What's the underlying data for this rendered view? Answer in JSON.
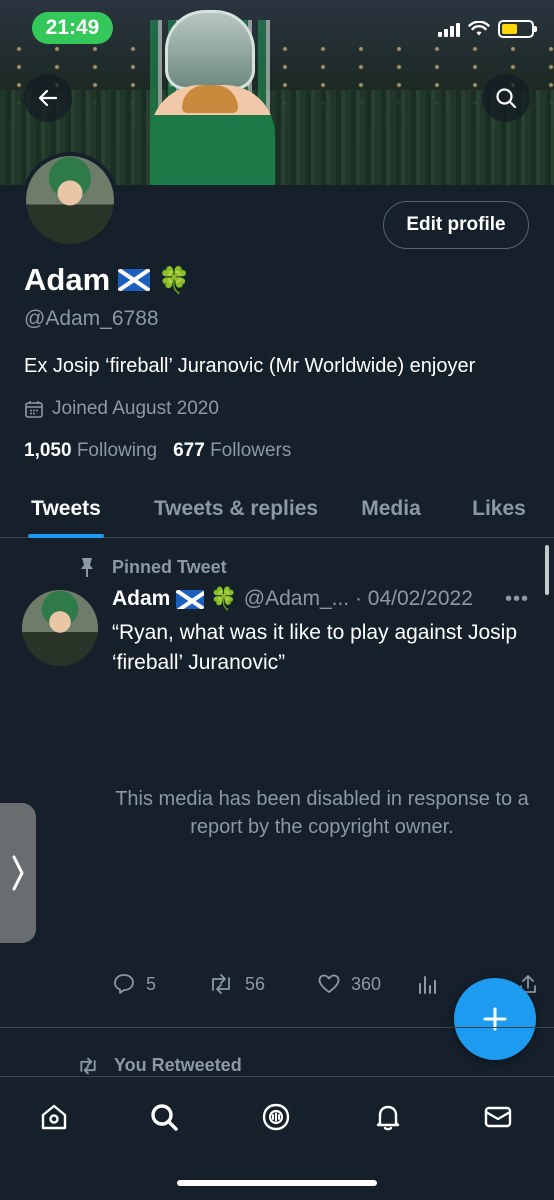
{
  "status_bar": {
    "time": "21:49",
    "battery_level": 0.55
  },
  "profile": {
    "display_name": "Adam",
    "handle": "@Adam_6788",
    "bio": "Ex Josip ‘fireball’ Juranovic (Mr Worldwide) enjoyer",
    "joined": "Joined August 2020",
    "following_count": "1,050",
    "following_label": "Following",
    "followers_count": "677",
    "followers_label": "Followers",
    "edit_label": "Edit profile",
    "clover": "🍀"
  },
  "tabs": [
    {
      "label": "Tweets",
      "active": true
    },
    {
      "label": "Tweets & replies",
      "active": false
    },
    {
      "label": "Media",
      "active": false
    },
    {
      "label": "Likes",
      "active": false
    }
  ],
  "pinned_tweet": {
    "pinned_label": "Pinned Tweet",
    "author": "Adam",
    "handle_date": "@Adam_... · 04/02/2022",
    "more": "•••",
    "text": "“Ryan, what was it like to play against Josip ‘fireball’ Juranovic”",
    "media_notice": "This media has been disabled in response to a report by the copyright owner.",
    "replies": "5",
    "retweets": "56",
    "likes": "360"
  },
  "next_item": {
    "label": "You Retweeted"
  },
  "colors": {
    "background": "#15202b",
    "accent": "#1d9bf0",
    "muted": "#8b98a5",
    "status_green": "#34c759"
  },
  "icons": {
    "back": "arrow-left-icon",
    "search": "search-icon",
    "calendar": "calendar-icon",
    "pin": "pin-icon",
    "reply": "reply-icon",
    "retweet": "retweet-icon",
    "like": "heart-icon",
    "analytics": "analytics-icon",
    "share": "share-icon",
    "compose": "plus-icon",
    "home": "home-icon",
    "explore": "search-icon",
    "spaces": "spaces-icon",
    "notifications": "bell-icon",
    "messages": "mail-icon"
  }
}
